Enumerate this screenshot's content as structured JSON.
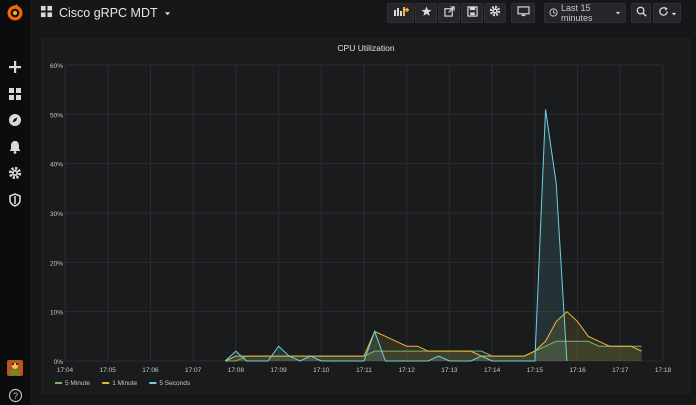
{
  "dashboard": {
    "title": "Cisco gRPC MDT"
  },
  "toolbar": {
    "time_range": "Last 15 minutes"
  },
  "colors": {
    "five_minute": "#7eb26d",
    "one_minute": "#eab839",
    "five_seconds": "#6ed0e0",
    "grid": "#2b2d31",
    "text": "#c7c8ca"
  },
  "icons": {
    "sidebar": [
      "grafana-logo-icon",
      "plus-icon",
      "dashboards-icon",
      "explore-icon",
      "bell-icon",
      "gear-icon",
      "shield-icon",
      "avatar",
      "help-icon"
    ],
    "toolbar": [
      "add-panel-icon",
      "star-icon",
      "share-icon",
      "save-icon",
      "settings-icon",
      "tv-icon",
      "clock-icon",
      "search-icon",
      "refresh-icon"
    ]
  },
  "sidebar": {
    "help_label": "?"
  },
  "chart_data": {
    "type": "line",
    "title": "CPU Utilization",
    "xlabel": "",
    "ylabel": "",
    "x_ticks": [
      "17:04",
      "17:05",
      "17:06",
      "17:07",
      "17:08",
      "17:09",
      "17:10",
      "17:11",
      "17:12",
      "17:13",
      "17:14",
      "17:15",
      "17:16",
      "17:17",
      "17:18"
    ],
    "y_ticks": [
      "0%",
      "10%",
      "20%",
      "30%",
      "40%",
      "50%",
      "60%"
    ],
    "ylim": [
      0,
      60
    ],
    "xlim": [
      "17:04",
      "17:18"
    ],
    "grid": true,
    "legend_position": "bottom-left",
    "series": [
      {
        "name": "5 Minute",
        "x": [
          "17:07:45",
          "17:08:00",
          "17:08:15",
          "17:08:30",
          "17:08:45",
          "17:09:00",
          "17:09:15",
          "17:09:30",
          "17:09:45",
          "17:10:00",
          "17:10:15",
          "17:10:30",
          "17:10:45",
          "17:11:00",
          "17:11:15",
          "17:11:30",
          "17:11:45",
          "17:12:00",
          "17:12:15",
          "17:12:30",
          "17:12:45",
          "17:13:00",
          "17:13:15",
          "17:13:30",
          "17:13:45",
          "17:14:00",
          "17:14:15",
          "17:14:30",
          "17:14:45",
          "17:15:00",
          "17:15:15",
          "17:15:30",
          "17:15:45",
          "17:16:00",
          "17:16:15",
          "17:16:30",
          "17:16:45",
          "17:17:00",
          "17:17:15",
          "17:17:30"
        ],
        "values": [
          0,
          0,
          1,
          1,
          1,
          1,
          1,
          1,
          1,
          1,
          1,
          1,
          1,
          1,
          2,
          2,
          2,
          2,
          2,
          2,
          2,
          2,
          2,
          2,
          2,
          1,
          1,
          1,
          1,
          2,
          3,
          4,
          4,
          4,
          4,
          3,
          3,
          3,
          3,
          3
        ]
      },
      {
        "name": "1 Minute",
        "x": [
          "17:07:45",
          "17:08:00",
          "17:08:15",
          "17:08:30",
          "17:08:45",
          "17:09:00",
          "17:09:15",
          "17:09:30",
          "17:09:45",
          "17:10:00",
          "17:10:15",
          "17:10:30",
          "17:10:45",
          "17:11:00",
          "17:11:15",
          "17:11:30",
          "17:11:45",
          "17:12:00",
          "17:12:15",
          "17:12:30",
          "17:12:45",
          "17:13:00",
          "17:13:15",
          "17:13:30",
          "17:13:45",
          "17:14:00",
          "17:14:15",
          "17:14:30",
          "17:14:45",
          "17:15:00",
          "17:15:15",
          "17:15:30",
          "17:15:45",
          "17:16:00",
          "17:16:15",
          "17:16:30",
          "17:16:45",
          "17:17:00",
          "17:17:15",
          "17:17:30"
        ],
        "values": [
          0,
          1,
          1,
          1,
          1,
          1,
          1,
          1,
          1,
          1,
          1,
          1,
          1,
          1,
          6,
          5,
          4,
          3,
          3,
          2,
          2,
          2,
          2,
          2,
          1,
          1,
          1,
          1,
          1,
          2,
          4,
          8,
          10,
          8,
          5,
          4,
          3,
          3,
          3,
          2
        ]
      },
      {
        "name": "5 Seconds",
        "x": [
          "17:07:45",
          "17:08:00",
          "17:08:15",
          "17:08:30",
          "17:08:45",
          "17:09:00",
          "17:09:15",
          "17:09:30",
          "17:09:45",
          "17:10:00",
          "17:10:15",
          "17:10:30",
          "17:10:45",
          "17:11:00",
          "17:11:15",
          "17:11:30",
          "17:11:45",
          "17:12:00",
          "17:12:15",
          "17:12:30",
          "17:12:45",
          "17:13:00",
          "17:13:15",
          "17:13:30",
          "17:13:45",
          "17:14:00",
          "17:14:15",
          "17:14:30",
          "17:14:45",
          "17:15:00",
          "17:15:15",
          "17:15:30",
          "17:15:45"
        ],
        "values": [
          0,
          2,
          0,
          0,
          0,
          3,
          1,
          0,
          1,
          0,
          0,
          0,
          0,
          0,
          6,
          0,
          0,
          0,
          0,
          0,
          1,
          0,
          0,
          0,
          1,
          0,
          0,
          0,
          0,
          0,
          51,
          36,
          0
        ]
      }
    ]
  }
}
